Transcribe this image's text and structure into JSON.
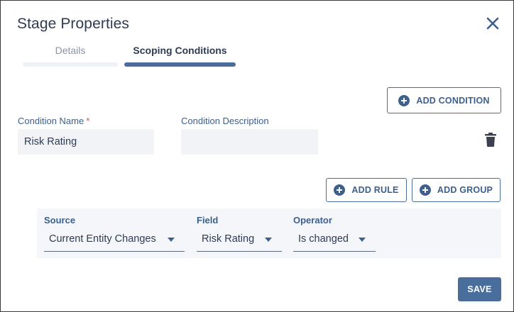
{
  "dialog": {
    "title": "Stage Properties",
    "close_icon": "close-icon"
  },
  "tabs": [
    {
      "label": "Details",
      "active": false
    },
    {
      "label": "Scoping Conditions",
      "active": true
    }
  ],
  "condition": {
    "add_condition_label": "ADD CONDITION",
    "name_label": "Condition Name",
    "required_marker": "*",
    "name_value": "Risk Rating",
    "description_label": "Condition Description",
    "description_value": "",
    "delete_icon": "trash-icon"
  },
  "rules": {
    "add_rule_label": "ADD RULE",
    "add_group_label": "ADD GROUP",
    "columns": [
      {
        "label": "Source",
        "value": "Current Entity Changes"
      },
      {
        "label": "Field",
        "value": "Risk Rating"
      },
      {
        "label": "Operator",
        "value": "Is changed"
      }
    ]
  },
  "footer": {
    "save_label": "SAVE"
  },
  "colors": {
    "accent": "#4a6e9b",
    "text": "#2f3b52",
    "required": "#d9534f",
    "input_bg": "#f1f3f7"
  }
}
